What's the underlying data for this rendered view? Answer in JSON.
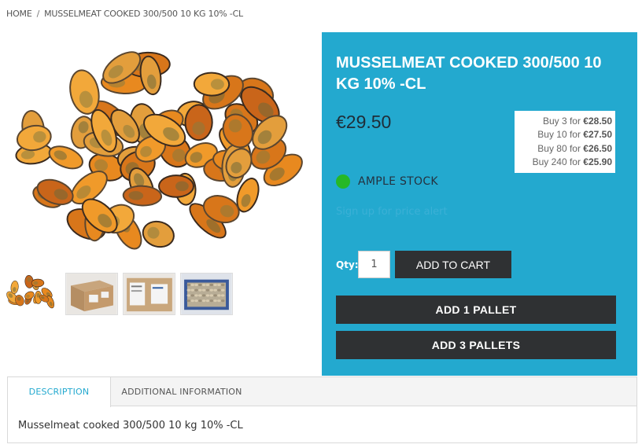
{
  "breadcrumb": {
    "home": "HOME",
    "separator": "/",
    "current": "MUSSELMEAT COOKED 300/500 10 KG 10% -CL"
  },
  "product": {
    "title": "MUSSELMEAT COOKED 300/500 10 KG 10% -CL",
    "price": "€29.50",
    "tiers": [
      {
        "prefix": "Buy 3 for ",
        "price": "€28.50"
      },
      {
        "prefix": "Buy 10 for ",
        "price": "€27.50"
      },
      {
        "prefix": "Buy 80 for ",
        "price": "€26.50"
      },
      {
        "prefix": "Buy 240 for ",
        "price": "€25.90"
      }
    ],
    "stock_status": "AMPLE STOCK",
    "stock_color": "#26b826",
    "price_alert_link": "Sign up for price alert",
    "qty_label": "Qty:",
    "qty_value": "1",
    "add_to_cart": "ADD TO CART",
    "add_1_pallet": "ADD 1 PALLET",
    "add_3_pallets": "ADD 3 PALLETS"
  },
  "colors": {
    "panel": "#23a9cf",
    "button": "#2f3133"
  },
  "tabs": [
    {
      "label": "DESCRIPTION",
      "active": true
    },
    {
      "label": "ADDITIONAL INFORMATION",
      "active": false
    }
  ],
  "description": "Musselmeat cooked 300/500 10 kg 10% -CL"
}
